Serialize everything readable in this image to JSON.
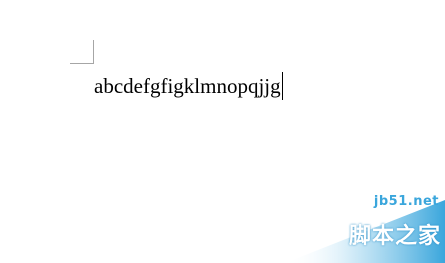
{
  "document": {
    "text": "abcdefgfigklmnopqjjg"
  },
  "watermark": {
    "site": "jb51.net",
    "name": "脚本之家",
    "color": "#3aa6dc"
  }
}
